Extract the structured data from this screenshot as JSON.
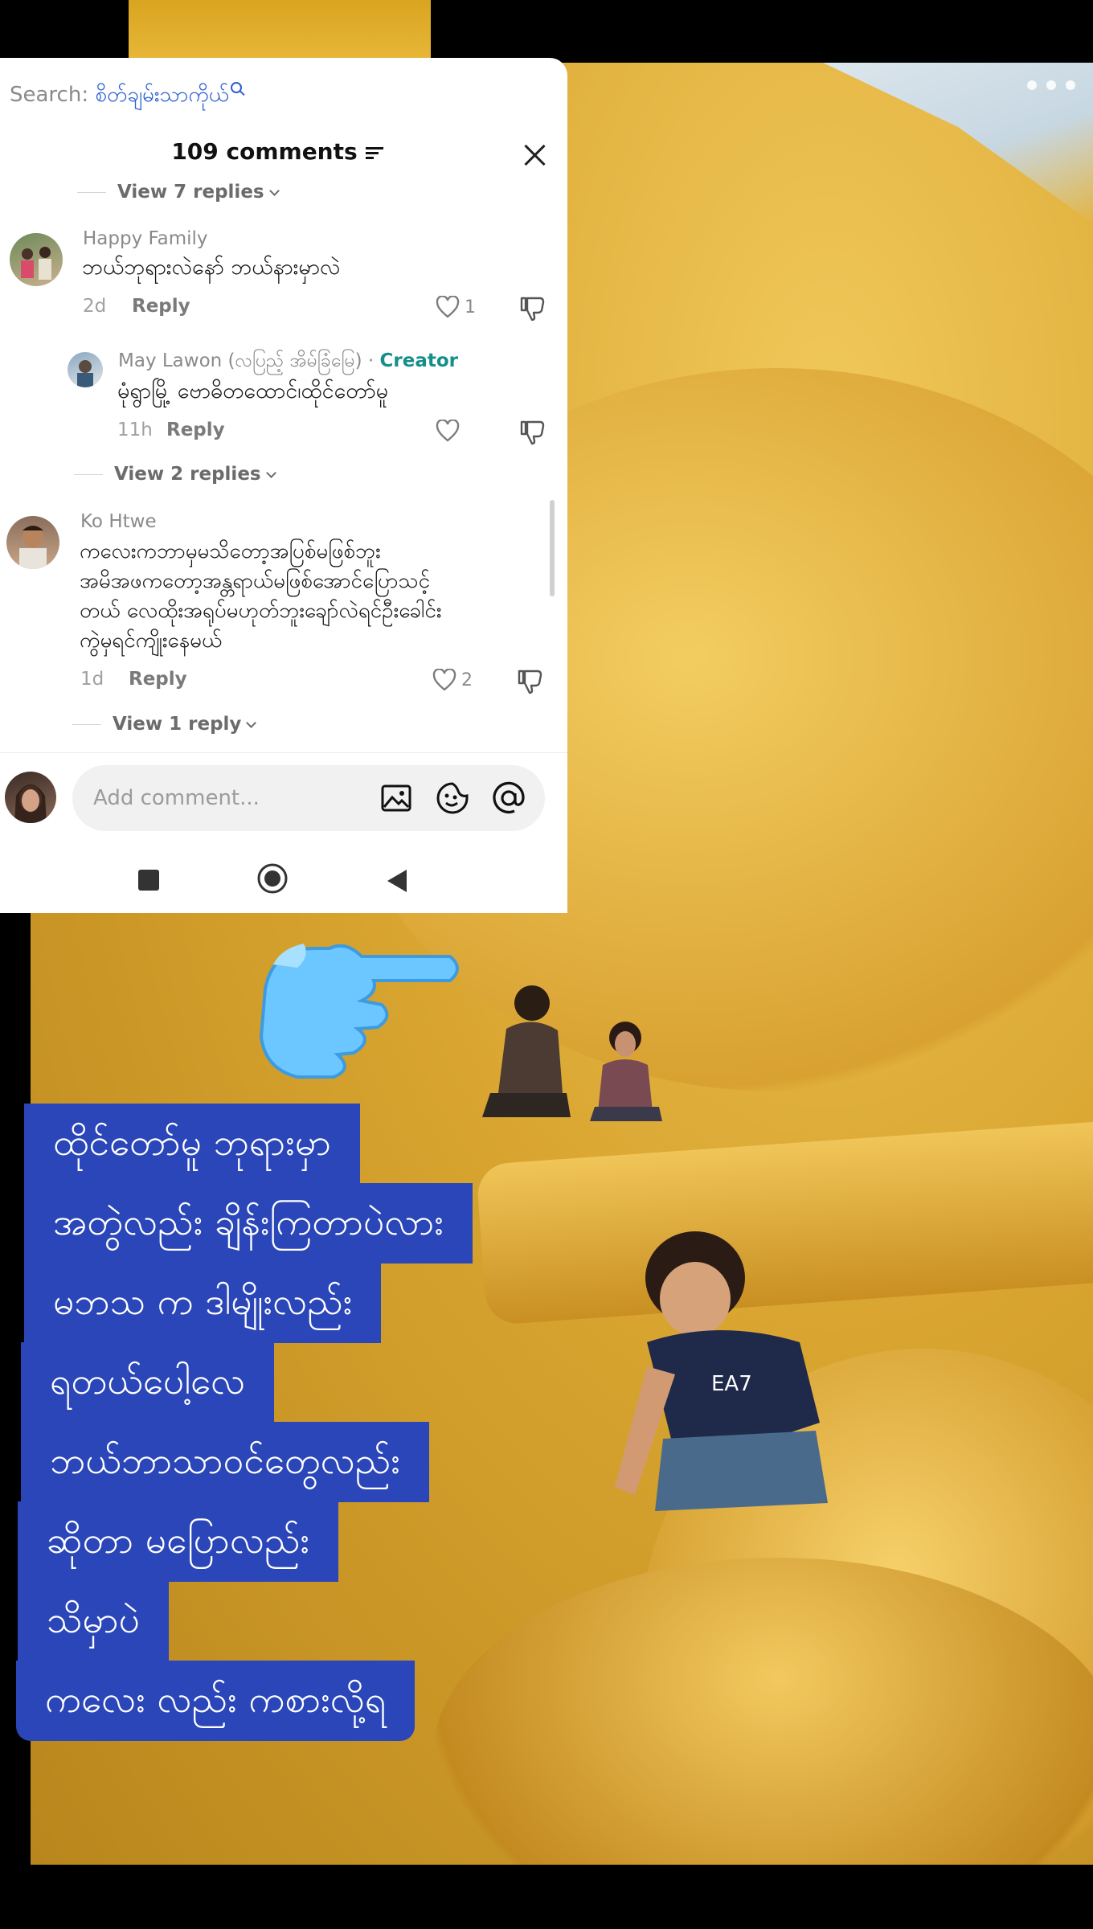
{
  "search": {
    "label": "Search: ",
    "query": "စိတ်ချမ်းသာကိုယ်"
  },
  "comments_header": {
    "title": "109 comments"
  },
  "thread_replies_top": "View 7 replies",
  "comments": [
    {
      "author": "Happy Family",
      "text": "ဘယ်ဘုရားလဲနော် ဘယ်နားမှာလဲ",
      "time": "2d",
      "reply_label": "Reply",
      "likes": "1"
    },
    {
      "author": "May Lawon (လပြည့် အိမ်ခြံမြေ)",
      "badge_sep": " · ",
      "badge": "Creator",
      "text": "မုံရွာမြို့ ဗောဓိတထောင်၊ထိုင်တော်မူ",
      "time": "11h",
      "reply_label": "Reply",
      "likes": ""
    },
    {
      "author": "Ko Htwe",
      "text_lines": [
        "ကလေးကဘာမှမသိတော့အပြစ်မဖြစ်ဘူး",
        "အမိအဖကတော့အန္တရာယ်မဖြစ်အောင်ပြောသင့်",
        "တယ် လေထိုးအရုပ်မဟုတ်ဘူးချော်လဲရင်ဦးခေါင်း",
        "ကွဲမှရင်ကျိုးနေမယ်"
      ],
      "time": "1d",
      "reply_label": "Reply",
      "likes": "2"
    }
  ],
  "replies_toggle": {
    "second": "View 2 replies",
    "third": "View 1 reply"
  },
  "input": {
    "placeholder": "Add comment..."
  },
  "caption_lines": [
    "ထိုင်တော်မူ ဘုရားမှာ",
    "အတွဲလည်း ချိန်းကြတာပဲလား",
    "မဘသ က ဒါမျိုးလည်း",
    "ရတယ်ပေါ့လေ",
    "ဘယ်ဘာသာဝင်တွေလည်း",
    "ဆိုတာ မပြောလည်း",
    "သိမှာပဲ",
    "ကလေး လည်း ကစားလို့ရ"
  ],
  "colors": {
    "caption_bg": "#2a46b8",
    "creator_badge": "#168f8a",
    "search_query": "#2c5fd1"
  },
  "icons": [
    "search-icon",
    "filter-icon",
    "close-icon",
    "heart-icon",
    "dislike-icon",
    "image-icon",
    "emoji-icon",
    "mention-icon",
    "pointing-hand-icon",
    "more-icon"
  ]
}
